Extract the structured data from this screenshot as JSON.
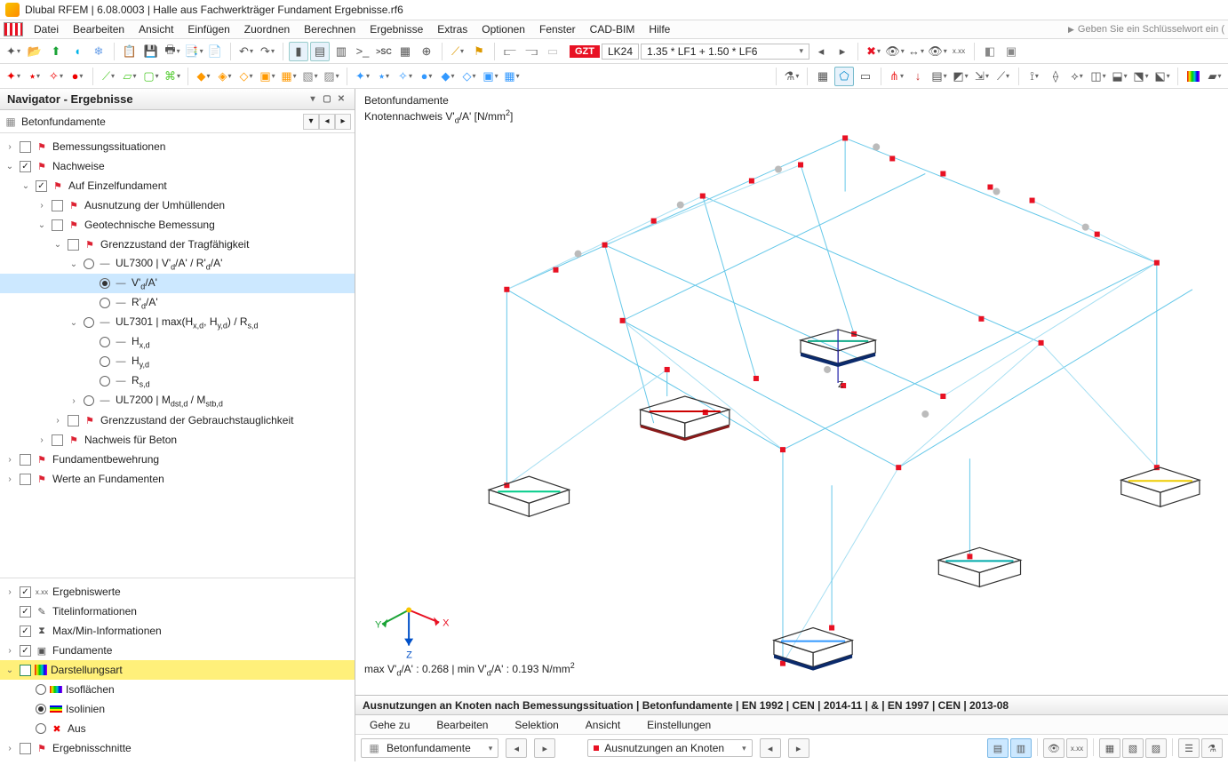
{
  "title": "Dlubal RFEM | 6.08.0003 | Halle aus Fachwerkträger Fundament Ergebnisse.rf6",
  "menubar": [
    "Datei",
    "Bearbeiten",
    "Ansicht",
    "Einfügen",
    "Zuordnen",
    "Berechnen",
    "Ergebnisse",
    "Extras",
    "Optionen",
    "Fenster",
    "CAD-BIM",
    "Hilfe"
  ],
  "search_hint": "Geben Sie ein Schlüsselwort ein (",
  "load": {
    "gzt": "GZT",
    "case": "LK24",
    "formula": "1.35 * LF1 + 1.50 * LF6"
  },
  "navigator": {
    "title": "Navigator - Ergebnisse",
    "subheader": "Betonfundamente"
  },
  "tree": {
    "bemessungssituationen": "Bemessungssituationen",
    "nachweise": "Nachweise",
    "auf_einzel": "Auf Einzelfundament",
    "ausnutzung_umh": "Ausnutzung der Umhüllenden",
    "geotech": "Geotechnische Bemessung",
    "gzt_trag": "Grenzzustand der Tragfähigkeit",
    "ul7300": "UL7300 | V'd/A' / R'd/A'",
    "vda": "V'd/A'",
    "rda": "R'd/A'",
    "ul7301": "UL7301 | max(Hx,d, Hy,d) / Rs,d",
    "hxd": "Hx,d",
    "hyd": "Hy,d",
    "rsd": "Rs,d",
    "ul7200": "UL7200 | Mdst,d / Mstb,d",
    "gzt_geb": "Grenzzustand der Gebrauchstauglichkeit",
    "nachweis_beton": "Nachweis für Beton",
    "fundamentbewehrung": "Fundamentbewehrung",
    "werte_fund": "Werte an Fundamenten"
  },
  "tree2": {
    "ergebniswerte": "Ergebniswerte",
    "titelinfo": "Titelinformationen",
    "maxmin": "Max/Min-Informationen",
    "fundamente": "Fundamente",
    "darstellungsart": "Darstellungsart",
    "isoflaechen": "Isoflächen",
    "isolinien": "Isolinien",
    "aus": "Aus",
    "ergebnisschnitte": "Ergebnisschnitte"
  },
  "viewport": {
    "label1": "Betonfundamente",
    "label2_a": "Knotennachweis V'",
    "label2_b": "/A' [N/mm",
    "label2_c": "]",
    "bottom_a": "max V'",
    "bottom_b": "/A' : 0.268 | min V'",
    "bottom_c": "/A' : 0.193 N/mm",
    "sub_d": "d",
    "sup_2": "2"
  },
  "dock": {
    "header": "Ausnutzungen an Knoten nach Bemessungssituation | Betonfundamente | EN 1992 | CEN | 2014-11 | & | EN 1997 | CEN | 2013-08",
    "menu": [
      "Gehe zu",
      "Bearbeiten",
      "Selektion",
      "Ansicht",
      "Einstellungen"
    ],
    "combo1": "Betonfundamente",
    "combo2": "Ausnutzungen an Knoten"
  },
  "axis": {
    "x": "X",
    "y": "Y",
    "z": "Z"
  }
}
